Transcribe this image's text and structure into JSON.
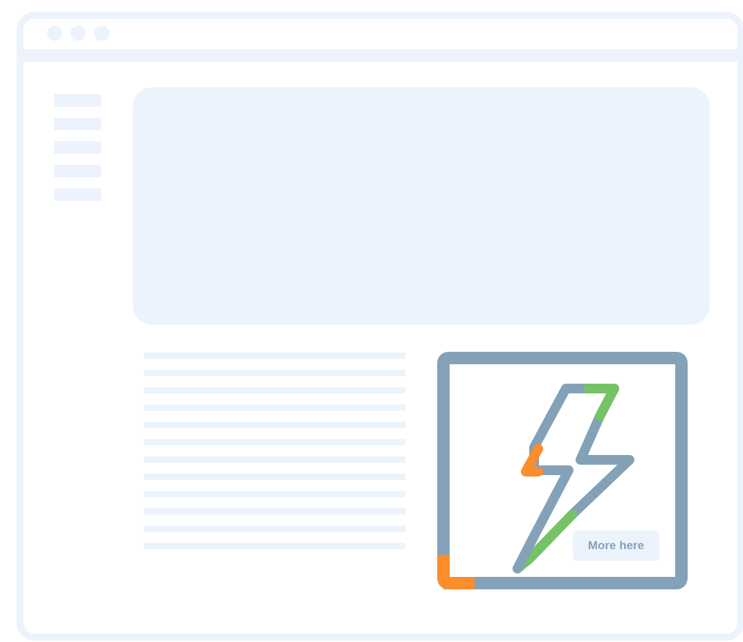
{
  "colors": {
    "frame": "#edf3fc",
    "accent_blue_grey": "#84a2b7",
    "accent_orange": "#fb8d2a",
    "accent_green": "#76c266",
    "background": "#ffffff"
  },
  "feature_card": {
    "icon": "lightning-bolt-icon",
    "button_label": "More here"
  }
}
